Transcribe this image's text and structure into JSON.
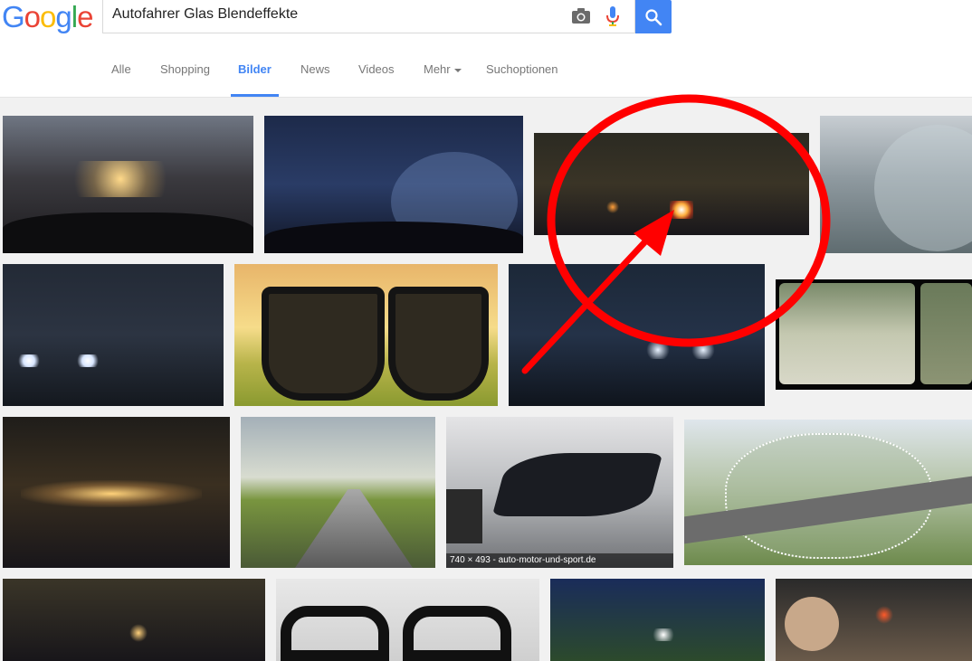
{
  "header": {
    "logo": [
      "G",
      "o",
      "o",
      "g",
      "l",
      "e"
    ],
    "logo_colors": [
      "#4285f4",
      "#ea4335",
      "#fbbc05",
      "#4285f4",
      "#34a853",
      "#ea4335"
    ],
    "query": "Autofahrer Glas Blendeffekte",
    "camera_icon": "camera-icon",
    "mic_icon": "microphone-icon",
    "search_icon": "search-icon",
    "accent": "#4285f4"
  },
  "tabs": {
    "all": "Alle",
    "shopping": "Shopping",
    "images": "Bilder",
    "news": "News",
    "videos": "Videos",
    "more": "Mehr",
    "options": "Suchoptionen"
  },
  "results": {
    "hover_caption": "740 × 493 - auto-motor-und-sport.de"
  },
  "annotation": {
    "color": "#ff0000"
  }
}
